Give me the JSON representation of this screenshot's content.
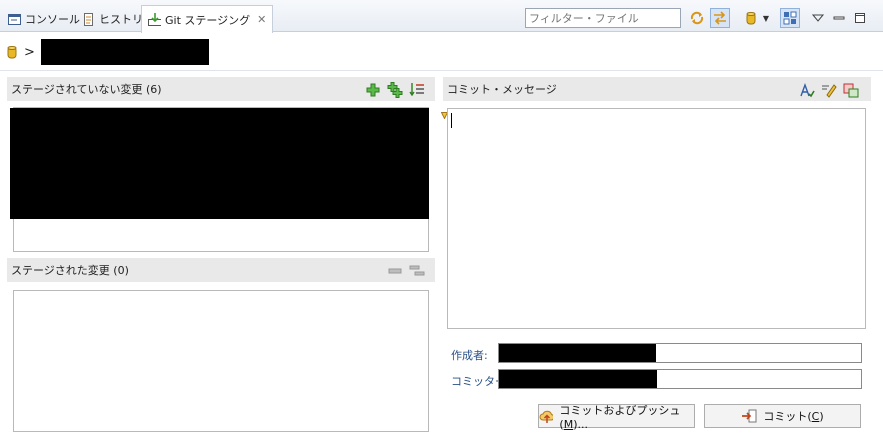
{
  "tabs": [
    {
      "label": "コンソール",
      "icon": "console-icon"
    },
    {
      "label": "ヒストリー",
      "icon": "history-icon"
    },
    {
      "label": "Git ステージング",
      "icon": "git-staging-icon",
      "active": true
    }
  ],
  "filter": {
    "placeholder": "フィルター・ファイル"
  },
  "repo": {
    "separator": ">"
  },
  "unstaged": {
    "title": "ステージされていない変更 (6)"
  },
  "staged": {
    "title": "ステージされた変更 (0)"
  },
  "commit": {
    "title": "コミット・メッセージ",
    "author_label": "作成者:",
    "committer_label": "コミッター:"
  },
  "buttons": {
    "commit_push": {
      "label": "コミットおよびプッシュ(",
      "mnemonic": "M",
      "suffix": ")..."
    },
    "commit": {
      "label": "コミット(",
      "mnemonic": "C",
      "suffix": ")"
    }
  },
  "colors": {
    "accent_green": "#3c9b2f",
    "repo_yellow": "#e8b828",
    "redaction": "#000000"
  }
}
